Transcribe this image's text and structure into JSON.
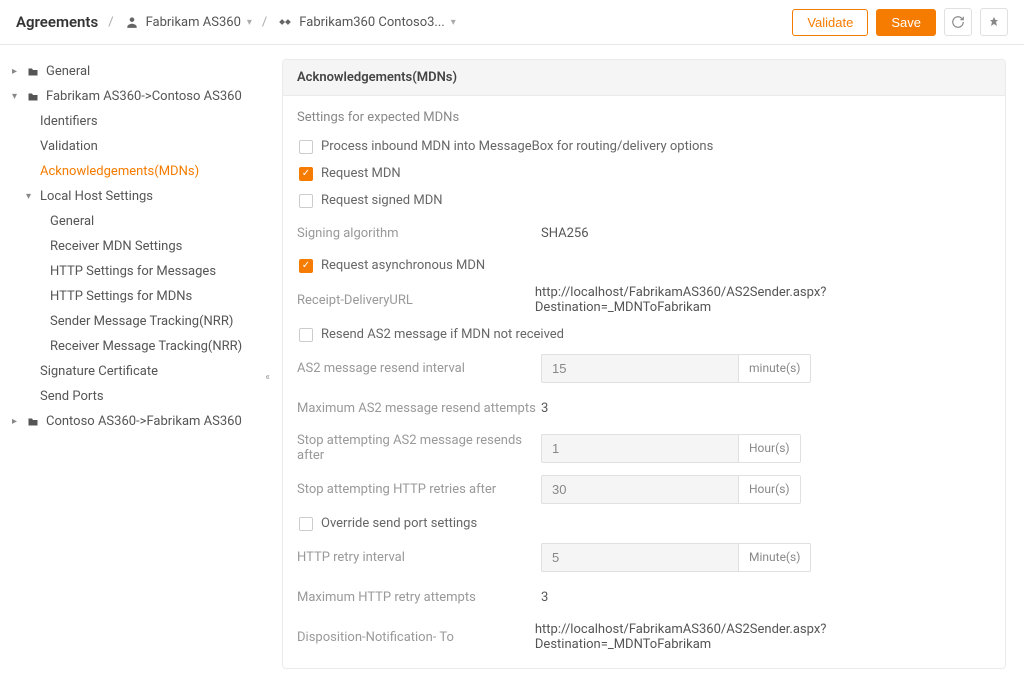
{
  "header": {
    "title": "Agreements",
    "crumb1": "Fabrikam AS360",
    "crumb2": "Fabrikam360 Contoso3...",
    "btn_validate": "Validate",
    "btn_save": "Save"
  },
  "sidebar": {
    "items": [
      {
        "label": "General",
        "lvl": 0,
        "caret": "right",
        "folder": true
      },
      {
        "label": "Fabrikam AS360->Contoso AS360",
        "lvl": 0,
        "caret": "down",
        "folder": true
      },
      {
        "label": "Identifiers",
        "lvl": 1
      },
      {
        "label": "Validation",
        "lvl": 1
      },
      {
        "label": "Acknowledgements(MDNs)",
        "lvl": 1,
        "active": true
      },
      {
        "label": "Local Host Settings",
        "lvl": 1,
        "caret": "down"
      },
      {
        "label": "General",
        "lvl": 2
      },
      {
        "label": "Receiver MDN Settings",
        "lvl": 2
      },
      {
        "label": "HTTP Settings for Messages",
        "lvl": 2
      },
      {
        "label": "HTTP Settings for MDNs",
        "lvl": 2
      },
      {
        "label": "Sender Message Tracking(NRR)",
        "lvl": 2
      },
      {
        "label": "Receiver Message Tracking(NRR)",
        "lvl": 2
      },
      {
        "label": "Signature Certificate",
        "lvl": 1
      },
      {
        "label": "Send Ports",
        "lvl": 1
      },
      {
        "label": "Contoso AS360->Fabrikam AS360",
        "lvl": 0,
        "caret": "right",
        "folder": true
      }
    ]
  },
  "panel": {
    "title": "Acknowledgements(MDNs)",
    "subtitle": "Settings for expected MDNs",
    "cb_process": "Process inbound MDN into MessageBox for routing/delivery options",
    "cb_request_mdn": "Request MDN",
    "cb_request_signed": "Request signed MDN",
    "lbl_sign_alg": "Signing algorithm",
    "val_sign_alg": "SHA256",
    "cb_request_async": "Request asynchronous MDN",
    "lbl_receipt_url": "Receipt-DeliveryURL",
    "val_receipt_url": "http://localhost/FabrikamAS360/AS2Sender.aspx?Destination=_MDNToFabrikam",
    "cb_resend": "Resend AS2 message if MDN not received",
    "lbl_resend_interval": "AS2 message resend interval",
    "val_resend_interval": "15",
    "unit_minutes": "minute(s)",
    "lbl_max_resend": "Maximum AS2 message resend attempts",
    "val_max_resend": "3",
    "lbl_stop_as2": "Stop attempting AS2 message resends after",
    "val_stop_as2": "1",
    "unit_hours": "Hour(s)",
    "lbl_stop_http": "Stop attempting HTTP retries after",
    "val_stop_http": "30",
    "cb_override": "Override send port settings",
    "lbl_http_retry": "HTTP retry interval",
    "val_http_retry": "5",
    "unit_minutes2": "Minute(s)",
    "lbl_max_http": "Maximum HTTP retry attempts",
    "val_max_http": "3",
    "lbl_disp_to": "Disposition-Notification- To",
    "val_disp_to": "http://localhost/FabrikamAS360/AS2Sender.aspx?Destination=_MDNToFabrikam"
  }
}
